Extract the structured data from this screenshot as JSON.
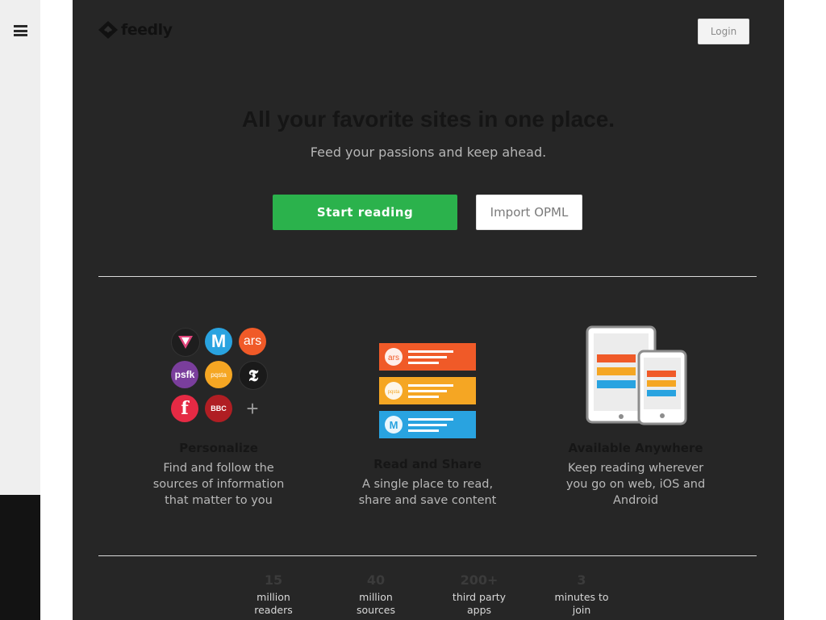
{
  "header": {
    "logo_text": "feedly",
    "login_label": "Login"
  },
  "hero": {
    "headline": "All your favorite sites in one place.",
    "subline": "Feed your passions and keep ahead.",
    "start_label": "Start reading",
    "import_label": "Import OPML"
  },
  "features": [
    {
      "title": "Personalize",
      "desc": [
        "Find and follow the",
        "sources of information",
        "that matter to you"
      ]
    },
    {
      "title": "Read and Share",
      "desc": [
        "A single place to read,",
        "share and save content"
      ]
    },
    {
      "title": "Available Anywhere",
      "desc": [
        "Keep reading wherever",
        "you go on web, iOS and",
        "Android"
      ]
    }
  ],
  "sources": [
    {
      "label": "",
      "color": "#1e1e1e"
    },
    {
      "label": "M",
      "color": "#29a3e0"
    },
    {
      "label": "ars",
      "color": "#f05a28"
    },
    {
      "label": "psfk",
      "color": "#7a3e9c"
    },
    {
      "label": "pqsta",
      "color": "#f5a623"
    },
    {
      "label": "𝕿",
      "color": "#1a1a1a"
    },
    {
      "label": "f",
      "color": "#e52a44"
    },
    {
      "label": "BBC",
      "color": "#b01e23"
    },
    {
      "label": "+",
      "color": "transparent"
    }
  ],
  "read_share_rows": [
    {
      "icon": "ars",
      "color": "#f05a28"
    },
    {
      "icon": "pqsta",
      "color": "#f5a623"
    },
    {
      "icon": "M",
      "color": "#29a3e0"
    }
  ],
  "stats": [
    {
      "num": "15",
      "lbl": [
        "million",
        "readers"
      ]
    },
    {
      "num": "40",
      "lbl": [
        "million",
        "sources"
      ]
    },
    {
      "num": "200+",
      "lbl": [
        "third party",
        "apps"
      ]
    },
    {
      "num": "3",
      "lbl": [
        "minutes to",
        "join"
      ]
    }
  ],
  "colors": {
    "accent_green": "#2bb24c",
    "panel_bg": "#262626"
  }
}
